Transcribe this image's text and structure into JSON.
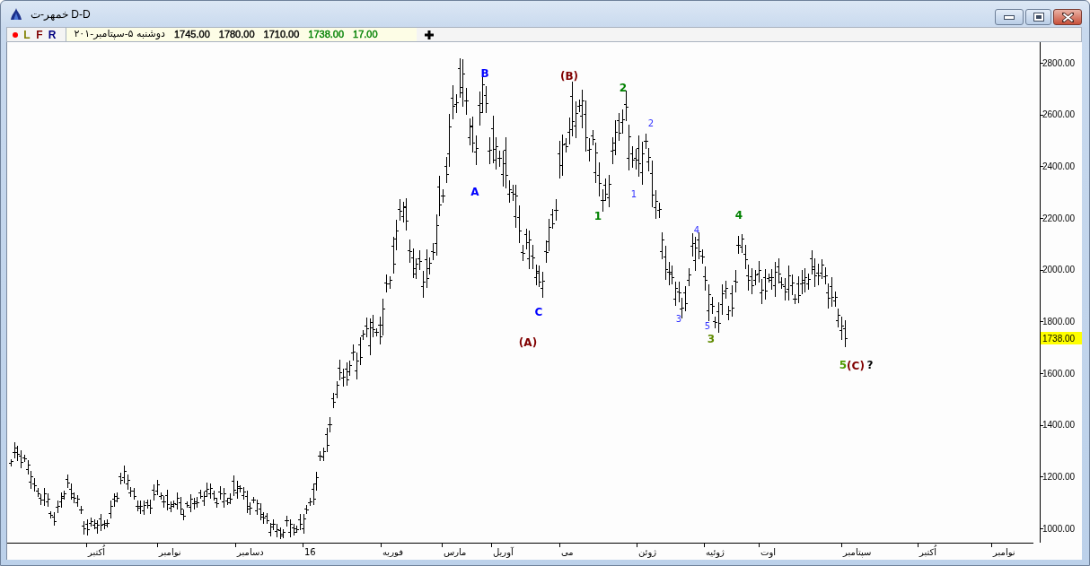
{
  "window": {
    "title": "خمهر-ت D-D"
  },
  "toolbar": {
    "quote": {
      "values": [
        {
          "text": "17.00",
          "color": "#008000"
        },
        {
          "text": "1738.00",
          "color": "#008000"
        },
        {
          "text": "1710.00",
          "color": "#000000"
        },
        {
          "text": "1780.00",
          "color": "#000000"
        },
        {
          "text": "1745.00",
          "color": "#000000"
        }
      ],
      "date": "دوشنبه ۵-سپتامبر-۲۰۱"
    },
    "buttons": [
      {
        "label": "R",
        "color": "#000080"
      },
      {
        "label": "F",
        "color": "#800000"
      },
      {
        "label": "L",
        "color": "#808000"
      }
    ]
  },
  "chart": {
    "y_axis": {
      "ticks": [
        "2800.00",
        "2600.00",
        "2400.00",
        "2200.00",
        "2000.00",
        "1800.00",
        "1600.00",
        "1400.00",
        "1200.00",
        "1000.00"
      ],
      "last_price": "1738.00"
    },
    "wave_labels": [
      {
        "text": "?",
        "color": "#000000",
        "kind": "major"
      },
      {
        "text": "(C)",
        "color": "#800000",
        "kind": "major"
      },
      {
        "text": "5",
        "color": "#4f9a00",
        "kind": "major"
      },
      {
        "text": "4",
        "color": "#008000",
        "kind": "major"
      },
      {
        "text": "3",
        "color": "#5f8a00",
        "kind": "major"
      },
      {
        "text": "5",
        "color": "#3333ff",
        "kind": "minor"
      },
      {
        "text": "4",
        "color": "#3333ff",
        "kind": "minor"
      },
      {
        "text": "3",
        "color": "#3333ff",
        "kind": "minor"
      },
      {
        "text": "2",
        "color": "#3333ff",
        "kind": "minor"
      },
      {
        "text": "1",
        "color": "#3333ff",
        "kind": "minor"
      },
      {
        "text": "2",
        "color": "#008000",
        "kind": "major"
      },
      {
        "text": "1",
        "color": "#008000",
        "kind": "major"
      },
      {
        "text": "(B)",
        "color": "#800000",
        "kind": "major"
      },
      {
        "text": "C",
        "color": "#0000ff",
        "kind": "major"
      },
      {
        "text": "(A)",
        "color": "#800000",
        "kind": "major"
      },
      {
        "text": "B",
        "color": "#0000ff",
        "kind": "major"
      },
      {
        "text": "A",
        "color": "#0000ff",
        "kind": "major"
      }
    ],
    "x_axis": {
      "ticks": [
        "نوامبر",
        "اُکتبر",
        "سپتامبر",
        "اوت",
        "ژوئیه",
        "ژوئن",
        "می",
        "آوریل",
        "مارس",
        "فوریه",
        "16",
        "دسامبر",
        "نوامبر",
        "اُکتبر"
      ]
    }
  }
}
